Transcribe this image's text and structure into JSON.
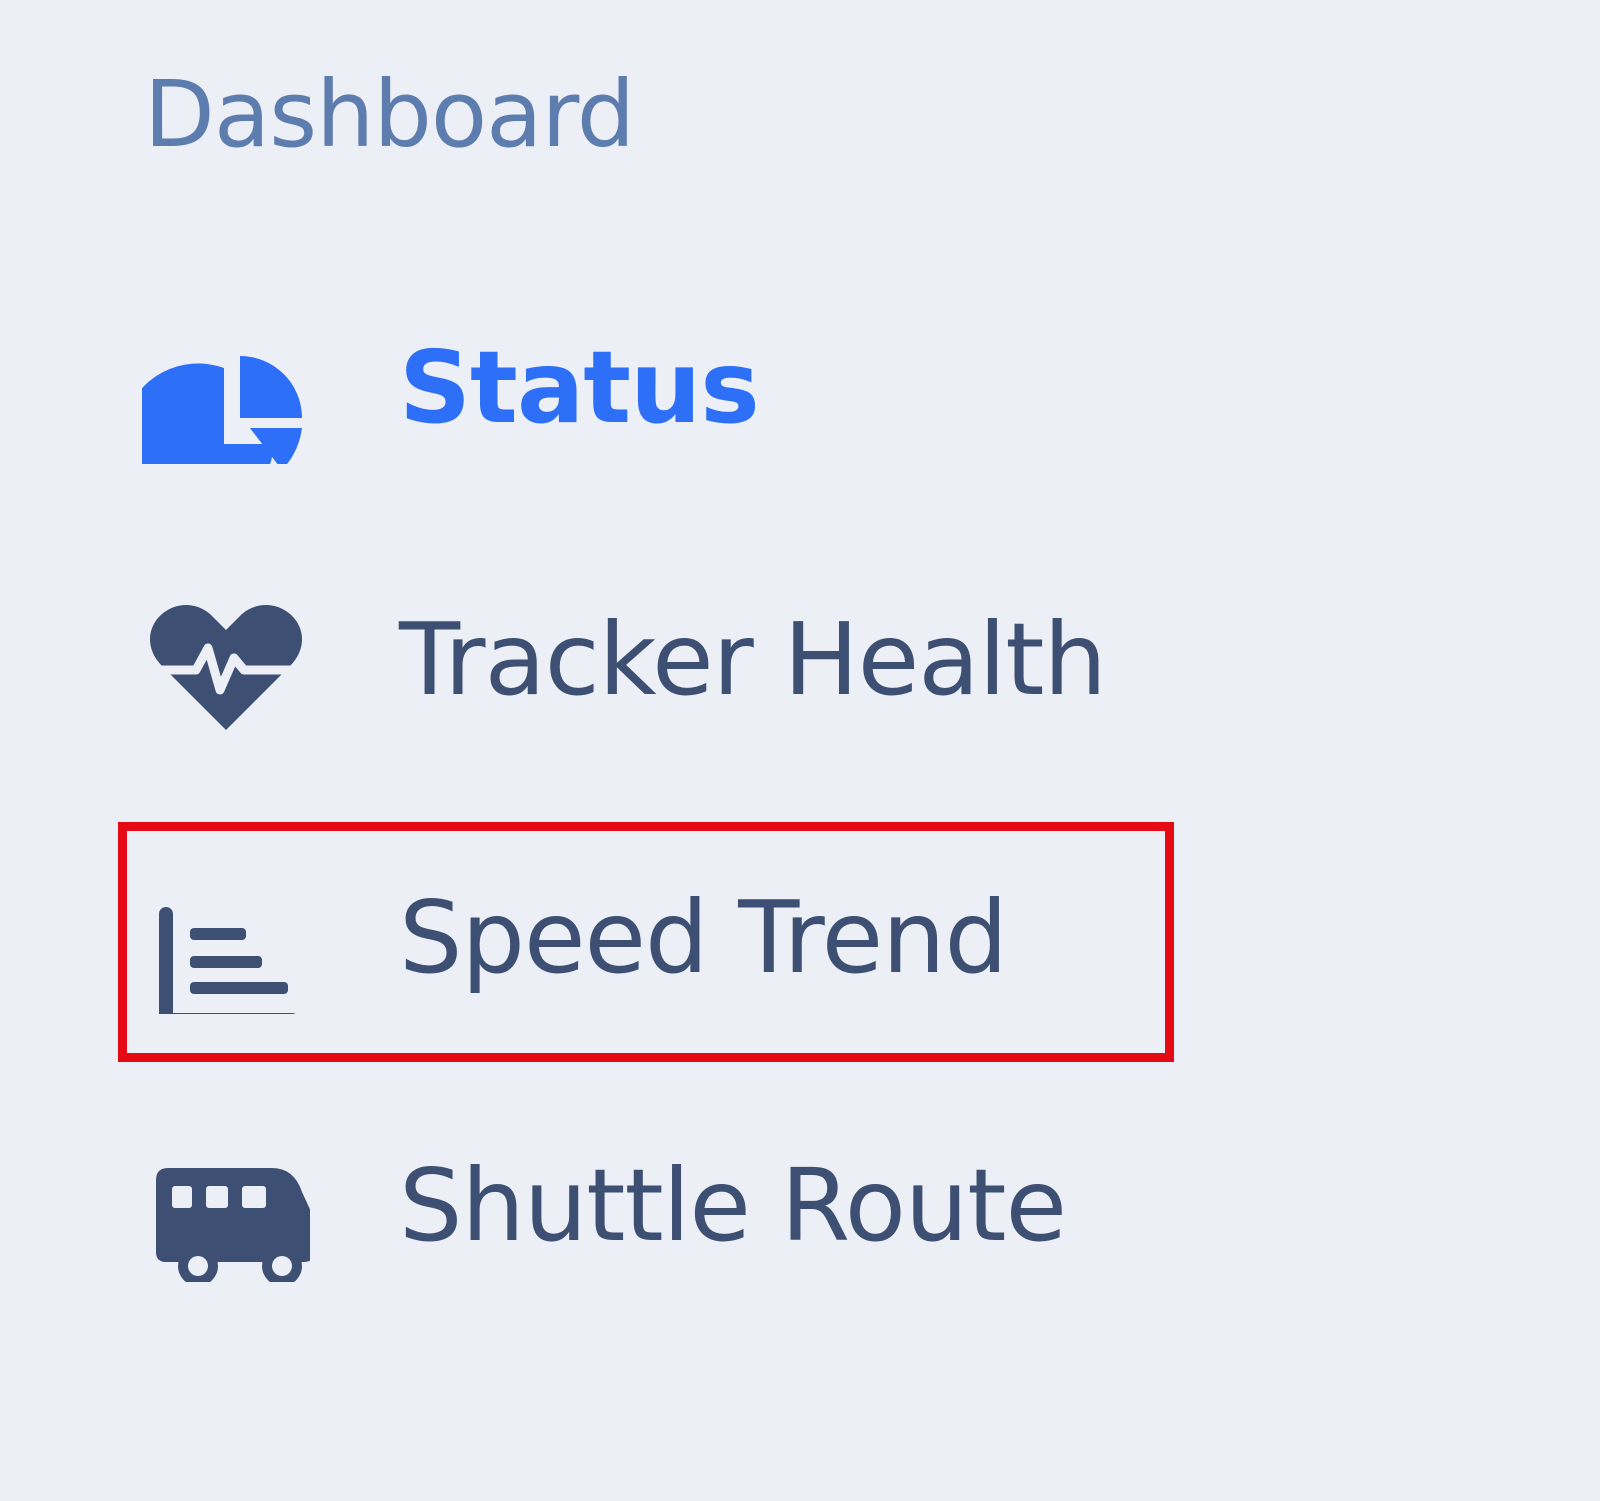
{
  "sidebar": {
    "section_title": "Dashboard",
    "items": [
      {
        "label": "Status",
        "icon": "pie-chart-icon",
        "active": true,
        "color": "#2D6FF7"
      },
      {
        "label": "Tracker Health",
        "icon": "heartbeat-icon",
        "active": false,
        "color": "#3D4F72"
      },
      {
        "label": "Speed Trend",
        "icon": "bar-chart-icon",
        "active": false,
        "highlighted": true,
        "color": "#3D4F72"
      },
      {
        "label": "Shuttle Route",
        "icon": "bus-icon",
        "active": false,
        "color": "#3D4F72"
      }
    ]
  },
  "colors": {
    "background": "#ECEFF5",
    "section_title": "#5E7DAF",
    "active": "#2D6FF7",
    "inactive": "#3D4F72",
    "highlight_border": "#E50914"
  }
}
